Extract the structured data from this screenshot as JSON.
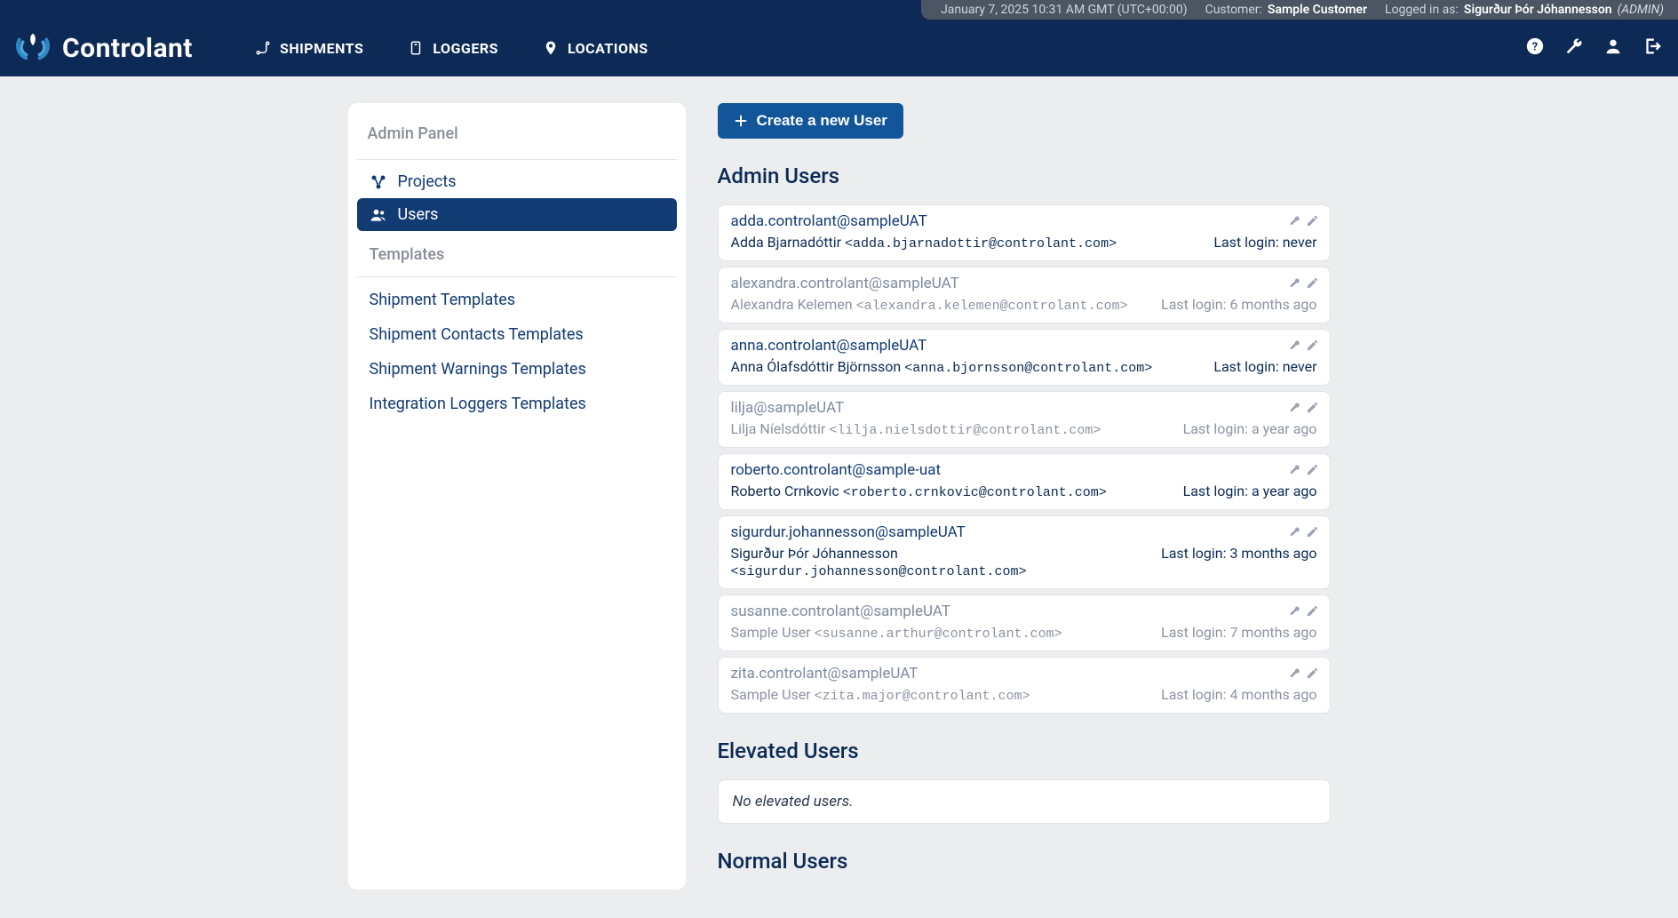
{
  "status": {
    "datetime": "January 7, 2025 10:31 AM GMT (UTC+00:00)",
    "customer_label": "Customer:",
    "customer_value": "Sample Customer",
    "logged_label": "Logged in as:",
    "logged_user": "Sigurður Þór Jóhannesson",
    "logged_role": "(ADMIN)"
  },
  "brand": "Controlant",
  "nav": {
    "shipments": "SHIPMENTS",
    "loggers": "LOGGERS",
    "locations": "LOCATIONS"
  },
  "sidebar": {
    "panel_title": "Admin Panel",
    "projects": "Projects",
    "users": "Users",
    "templates_title": "Templates",
    "shipment_templates": "Shipment Templates",
    "shipment_contacts": "Shipment Contacts Templates",
    "shipment_warnings": "Shipment Warnings Templates",
    "integration_loggers": "Integration Loggers Templates"
  },
  "main": {
    "create_label": "Create a new User",
    "admin_heading": "Admin Users",
    "elevated_heading": "Elevated Users",
    "elevated_empty": "No elevated users.",
    "normal_heading": "Normal Users",
    "last_login_prefix": "Last login: ",
    "users": [
      {
        "dim": false,
        "login": "adda.controlant@sampleUAT",
        "name": "Adda Bjarnadóttir",
        "email": "<adda.bjarnadottir@controlant.com>",
        "last": "never"
      },
      {
        "dim": true,
        "login": "alexandra.controlant@sampleUAT",
        "name": "Alexandra Kelemen",
        "email": "<alexandra.kelemen@controlant.com>",
        "last": "6 months ago"
      },
      {
        "dim": false,
        "login": "anna.controlant@sampleUAT",
        "name": "Anna Ólafsdóttir Björnsson",
        "email": "<anna.bjornsson@controlant.com>",
        "last": "never"
      },
      {
        "dim": true,
        "login": "lilja@sampleUAT",
        "name": "Lilja Níelsdóttir",
        "email": "<lilja.nielsdottir@controlant.com>",
        "last": "a year ago"
      },
      {
        "dim": false,
        "login": "roberto.controlant@sample-uat",
        "name": "Roberto Crnkovic",
        "email": "<roberto.crnkovic@controlant.com>",
        "last": "a year ago"
      },
      {
        "dim": false,
        "login": "sigurdur.johannesson@sampleUAT",
        "name": "Sigurður Þór Jóhannesson",
        "email": "<sigurdur.johannesson@controlant.com>",
        "last": "3 months ago"
      },
      {
        "dim": true,
        "login": "susanne.controlant@sampleUAT",
        "name": "Sample User",
        "email": "<susanne.arthur@controlant.com>",
        "last": "7 months ago"
      },
      {
        "dim": true,
        "login": "zita.controlant@sampleUAT",
        "name": "Sample User",
        "email": "<zita.major@controlant.com>",
        "last": "4 months ago"
      }
    ]
  }
}
